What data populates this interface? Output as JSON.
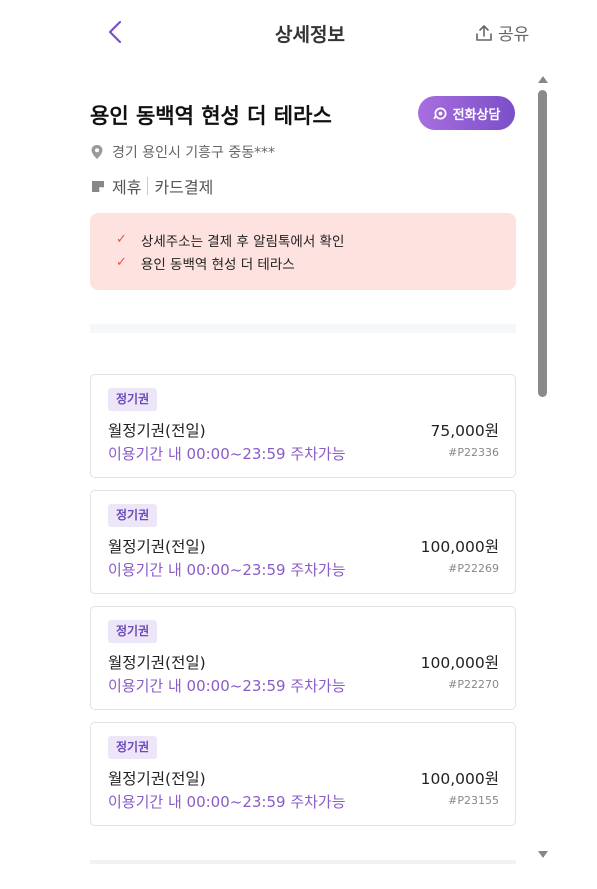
{
  "header": {
    "title": "상세정보",
    "share_label": "공유"
  },
  "lot": {
    "name": "용인 동백역 현성 더 테라스",
    "call_label": "전화상담",
    "address": "경기 용인시 기흥구 중동***",
    "tags": [
      "제휴",
      "카드결제"
    ]
  },
  "notice": {
    "items": [
      "상세주소는 결제 후 알림톡에서 확인",
      "용인 동백역 현성 더 테라스"
    ]
  },
  "tickets": [
    {
      "badge": "정기권",
      "name": "월정기권(전일)",
      "price": "75,000원",
      "time": "이용기간 내 00:00~23:59 주차가능",
      "code": "#P22336"
    },
    {
      "badge": "정기권",
      "name": "월정기권(전일)",
      "price": "100,000원",
      "time": "이용기간 내 00:00~23:59 주차가능",
      "code": "#P22269"
    },
    {
      "badge": "정기권",
      "name": "월정기권(전일)",
      "price": "100,000원",
      "time": "이용기간 내 00:00~23:59 주차가능",
      "code": "#P22270"
    },
    {
      "badge": "정기권",
      "name": "월정기권(전일)",
      "price": "100,000원",
      "time": "이용기간 내 00:00~23:59 주차가능",
      "code": "#P23155"
    }
  ],
  "colors": {
    "accent": "#7a4fc8",
    "notice_bg": "#fde2df",
    "check": "#e05a44"
  }
}
